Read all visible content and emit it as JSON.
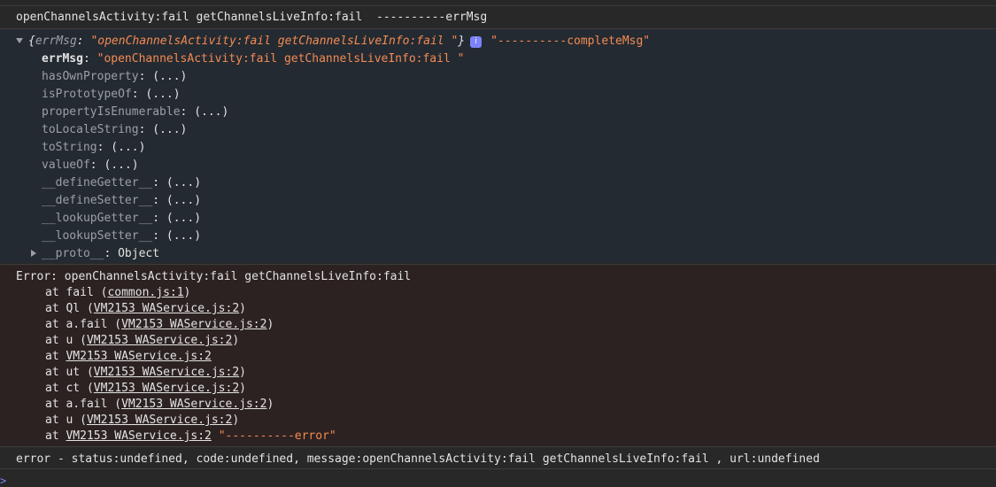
{
  "log1": "openChannelsActivity:fail getChannelsLiveInfo:fail  ----------errMsg",
  "object": {
    "summary_key": "errMsg",
    "summary_value": "\"openChannelsActivity:fail getChannelsLiveInfo:fail \"",
    "info_icon": "info-icon",
    "trailing": "\"----------completeMsg\"",
    "props": [
      {
        "key": "errMsg",
        "value": "\"openChannelsActivity:fail getChannelsLiveInfo:fail \""
      },
      {
        "key": "hasOwnProperty",
        "value": "(...)"
      },
      {
        "key": "isPrototypeOf",
        "value": "(...)"
      },
      {
        "key": "propertyIsEnumerable",
        "value": "(...)"
      },
      {
        "key": "toLocaleString",
        "value": "(...)"
      },
      {
        "key": "toString",
        "value": "(...)"
      },
      {
        "key": "valueOf",
        "value": "(...)"
      },
      {
        "key": "__defineGetter__",
        "value": "(...)"
      },
      {
        "key": "__defineSetter__",
        "value": "(...)"
      },
      {
        "key": "__lookupGetter__",
        "value": "(...)"
      },
      {
        "key": "__lookupSetter__",
        "value": "(...)"
      }
    ],
    "proto_key": "__proto__",
    "proto_value": "Object"
  },
  "error": {
    "title": "Error: openChannelsActivity:fail getChannelsLiveInfo:fail",
    "stack": [
      {
        "prefix": "at fail (",
        "link": "common.js:1",
        "suffix": ")"
      },
      {
        "prefix": "at Ql (",
        "link": "VM2153 WAService.js:2",
        "suffix": ")"
      },
      {
        "prefix": "at a.fail (",
        "link": "VM2153 WAService.js:2",
        "suffix": ")"
      },
      {
        "prefix": "at u (",
        "link": "VM2153 WAService.js:2",
        "suffix": ")"
      },
      {
        "prefix": "at ",
        "link": "VM2153 WAService.js:2",
        "suffix": ""
      },
      {
        "prefix": "at ut (",
        "link": "VM2153 WAService.js:2",
        "suffix": ")"
      },
      {
        "prefix": "at ct (",
        "link": "VM2153 WAService.js:2",
        "suffix": ")"
      },
      {
        "prefix": "at a.fail (",
        "link": "VM2153 WAService.js:2",
        "suffix": ")"
      },
      {
        "prefix": "at u (",
        "link": "VM2153 WAService.js:2",
        "suffix": ")"
      },
      {
        "prefix": "at ",
        "link": "VM2153 WAService.js:2",
        "suffix": " "
      }
    ],
    "trailing": "\"----------error\""
  },
  "log_last": "error - status:undefined, code:undefined, message:openChannelsActivity:fail getChannelsLiveInfo:fail , url:undefined",
  "prompt_icon": "chevron-right-icon"
}
